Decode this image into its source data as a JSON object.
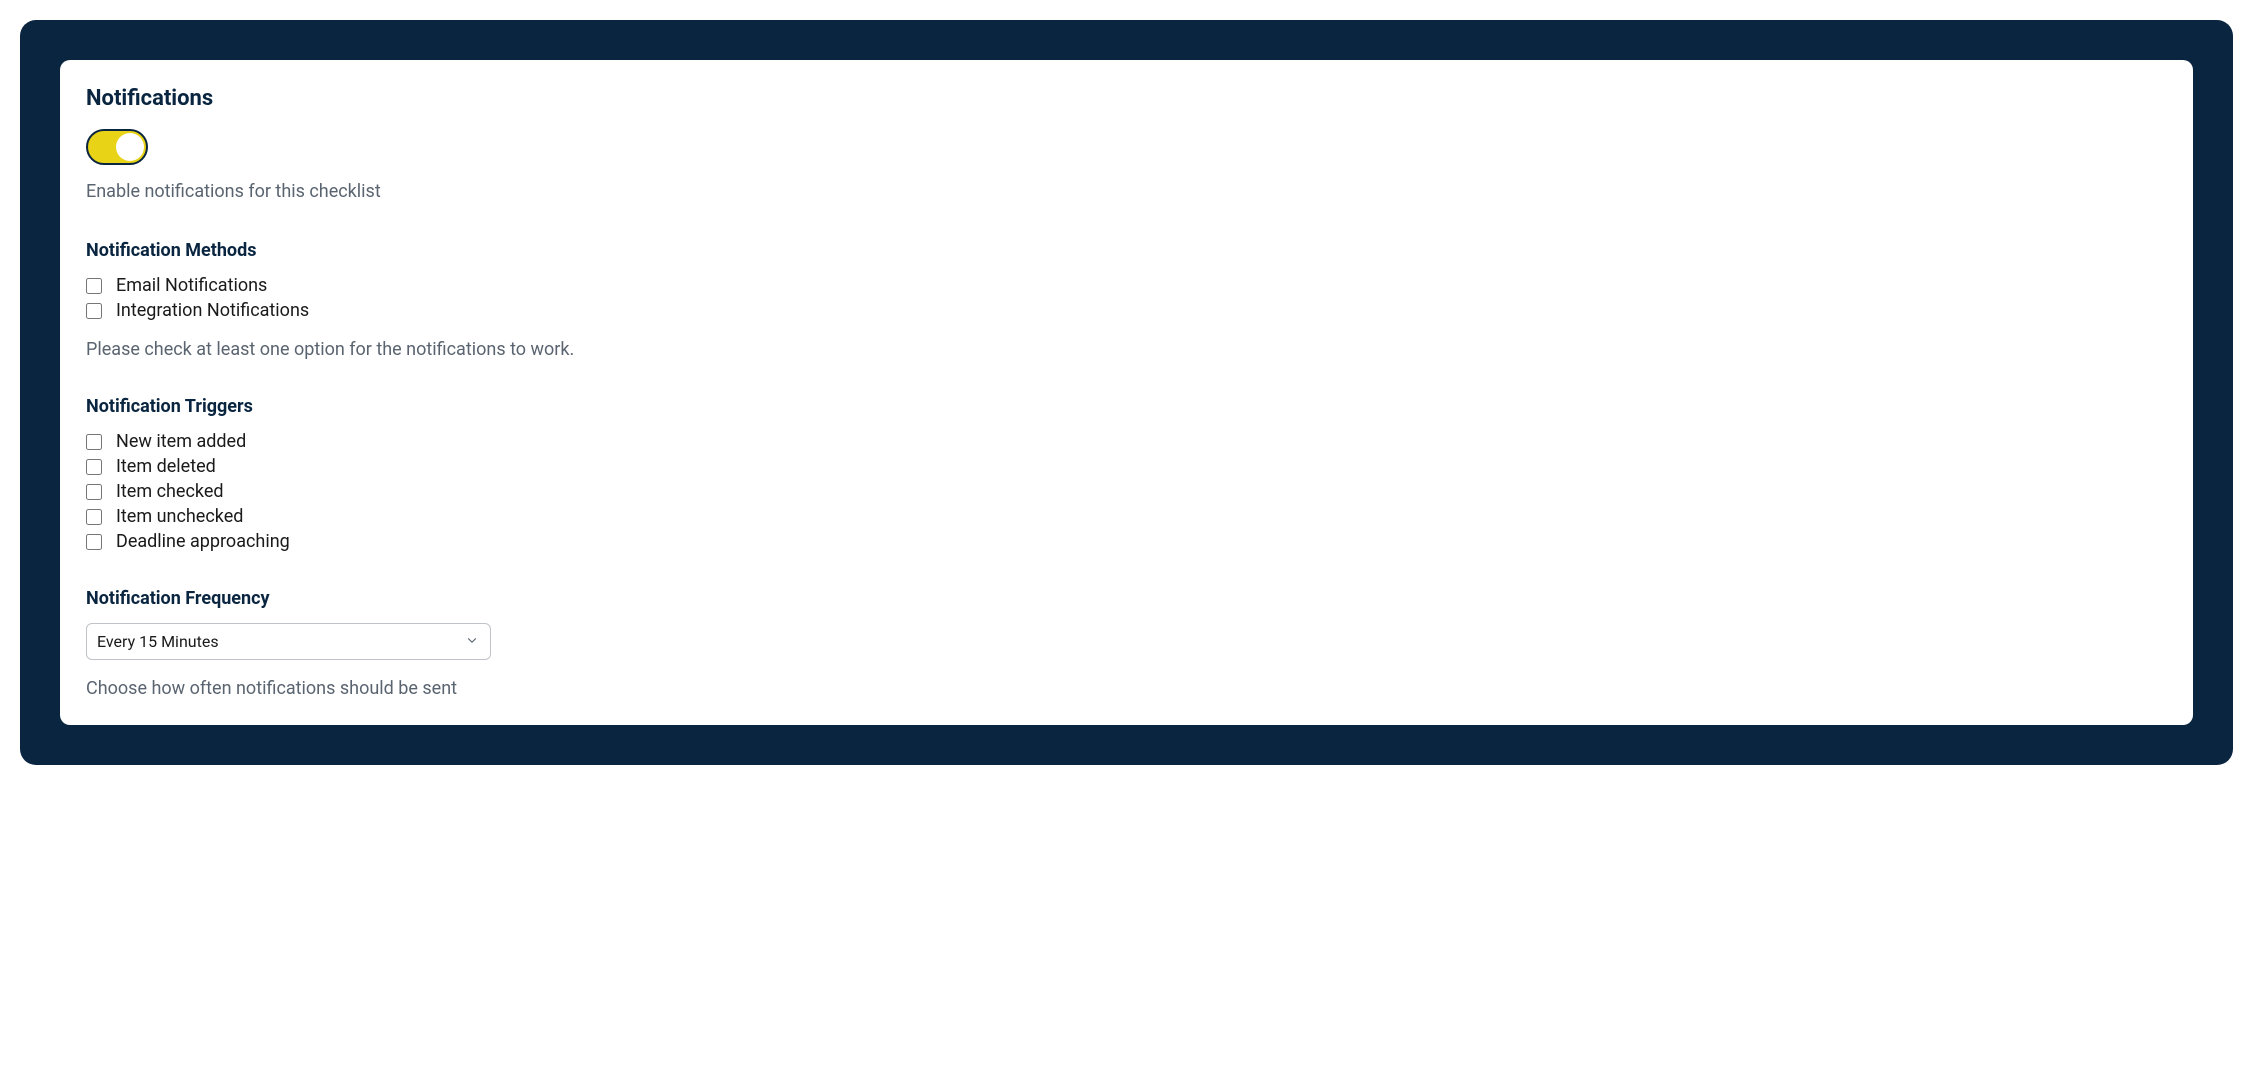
{
  "title": "Notifications",
  "toggle": {
    "description": "Enable notifications for this checklist"
  },
  "methods": {
    "heading": "Notification Methods",
    "options": [
      {
        "label": "Email Notifications"
      },
      {
        "label": "Integration Notifications"
      }
    ],
    "helper": "Please check at least one option for the notifications to work."
  },
  "triggers": {
    "heading": "Notification Triggers",
    "options": [
      {
        "label": "New item added"
      },
      {
        "label": "Item deleted"
      },
      {
        "label": "Item checked"
      },
      {
        "label": "Item unchecked"
      },
      {
        "label": "Deadline approaching"
      }
    ]
  },
  "frequency": {
    "heading": "Notification Frequency",
    "value": "Every 15 Minutes",
    "helper": "Choose how often notifications should be sent"
  }
}
